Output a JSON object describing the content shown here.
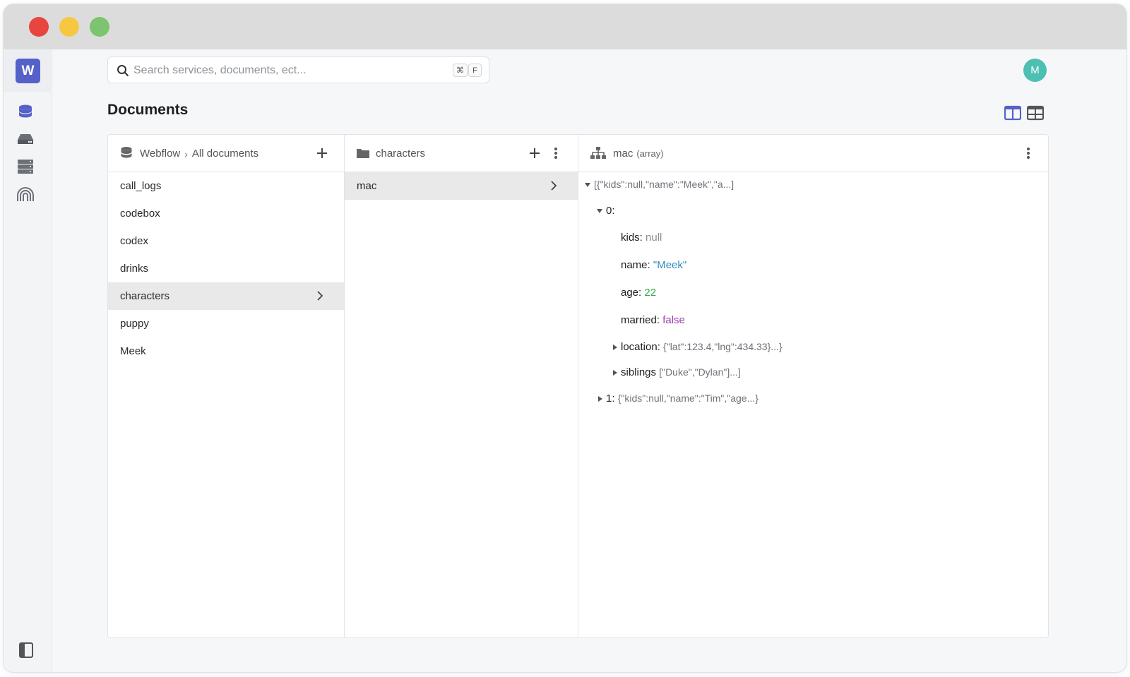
{
  "window": {
    "traffic_lights": [
      "close",
      "minimize",
      "zoom"
    ]
  },
  "sidebar": {
    "logo_letter": "W",
    "icons": [
      "database-icon",
      "drive-icon",
      "server-icon",
      "fingerprint-icon"
    ],
    "bottom_icon": "sidebar-toggle-icon"
  },
  "search": {
    "placeholder": "Search services, documents, ect...",
    "shortcut_cmd": "⌘",
    "shortcut_key": "F"
  },
  "user": {
    "avatar_letter": "M",
    "avatar_color": "#4dbfb3"
  },
  "page": {
    "title": "Documents"
  },
  "view_toggle": [
    "columns-view-icon",
    "grid-view-icon"
  ],
  "panel1": {
    "breadcrumb": {
      "root": "Webflow",
      "current": "All documents"
    },
    "items": [
      {
        "label": "call_logs",
        "selected": false
      },
      {
        "label": "codebox",
        "selected": false
      },
      {
        "label": "codex",
        "selected": false
      },
      {
        "label": "drinks",
        "selected": false
      },
      {
        "label": "characters",
        "selected": true
      },
      {
        "label": "puppy",
        "selected": false
      },
      {
        "label": "Meek",
        "selected": false
      }
    ]
  },
  "panel2": {
    "title": "characters",
    "items": [
      {
        "label": "mac",
        "selected": true
      }
    ]
  },
  "panel3": {
    "title": "mac",
    "type_label": "(array)",
    "root_preview": "[{\"kids\":null,\"name\":\"Meek\",\"a...]",
    "item0": {
      "index": "0:",
      "fields": [
        {
          "key": "kids:",
          "value": "null",
          "kind": "null"
        },
        {
          "key": "name:",
          "value": "\"Meek\"",
          "kind": "string"
        },
        {
          "key": "age:",
          "value": "22",
          "kind": "number"
        },
        {
          "key": "married:",
          "value": "false",
          "kind": "bool"
        }
      ],
      "location": {
        "key": "location:",
        "preview": "{\"lat\":123.4,\"lng\":434.33}...}"
      },
      "siblings": {
        "key": "siblings",
        "preview": "[\"Duke\",\"Dylan\"]...]"
      }
    },
    "item1": {
      "index": "1:",
      "preview": "{\"kids\":null,\"name\":\"Tim\",\"age...}"
    }
  },
  "colors": {
    "accent": "#5561c9",
    "string": "#2f8bbd",
    "number": "#3aa54a",
    "bool": "#9b3fb0"
  }
}
